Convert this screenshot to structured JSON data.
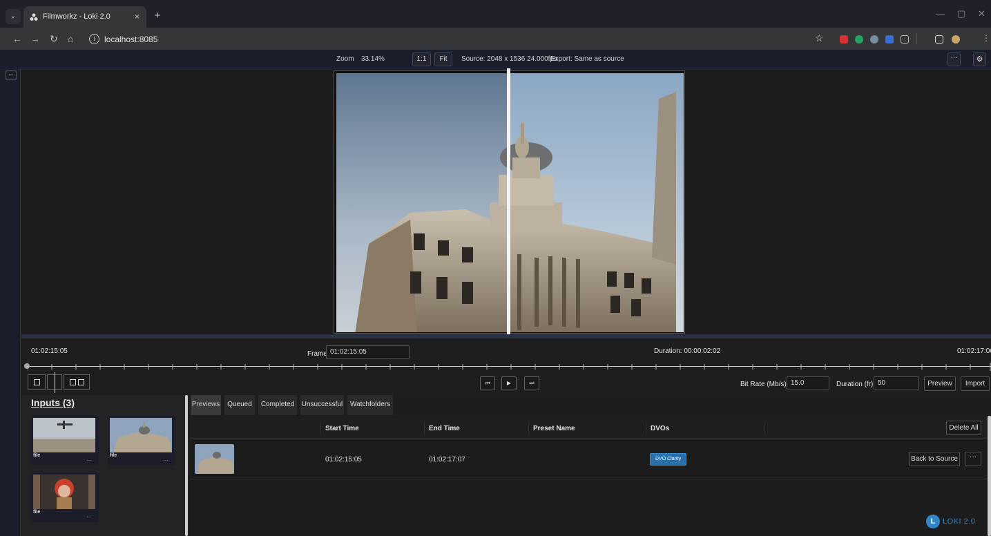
{
  "browser": {
    "tab_title": "Filmworkz - Loki 2.0",
    "tab_close": "×",
    "new_tab": "+",
    "url": "localhost:8085",
    "minimize": "—",
    "restore": "▢",
    "close": "✕"
  },
  "toolbar": {
    "zoom_label": "Zoom",
    "zoom_value": "33.14%",
    "one_to_one": "1:1",
    "fit": "Fit",
    "source_info": "Source: 2048 x 1536 24.000fps",
    "export_info": "Export: Same as source",
    "more": "···",
    "settings_icon": "gear-icon"
  },
  "gutter": {
    "more": "···"
  },
  "timeline": {
    "start_tc": "01:02:15:05",
    "frame_label": "Frame",
    "frame_value": "01:02:15:05",
    "duration": "Duration: 00:00:02:02",
    "end_tc": "01:02:17:06",
    "bitrate_label": "Bit Rate (Mb/s):",
    "bitrate_value": "15.0",
    "duration_fr_label": "Duration (fr):",
    "duration_fr_value": "50",
    "preview": "Preview",
    "import": "Import",
    "prev": "⏮",
    "play": "▶",
    "next": "⏭"
  },
  "inputs": {
    "title": "Inputs (3)",
    "items": [
      {
        "label": "file",
        "menu": "···",
        "thumb": "plane"
      },
      {
        "label": "file",
        "menu": "···",
        "thumb": "building"
      },
      {
        "label": "file",
        "menu": "···",
        "thumb": "child"
      }
    ]
  },
  "queue": {
    "tabs": [
      "Previews",
      "Queued",
      "Completed",
      "Unsuccessful",
      "Watchfolders"
    ],
    "active_tab": "Previews",
    "headers": {
      "start": "Start Time",
      "end": "End Time",
      "preset": "Preset Name",
      "dvos": "DVOs"
    },
    "delete_all": "Delete All",
    "rows": [
      {
        "start": "01:02:15:05",
        "end": "01:02:17:07",
        "preset": "",
        "dvo": "DVO Clarity",
        "action": "Back to Source",
        "menu": "···"
      }
    ]
  },
  "logo": {
    "mark": "L",
    "text": "LOKI 2.0"
  },
  "colors": {
    "accent": "#2f86c9",
    "badge": "#2a6fa8",
    "panel": "#1a1d2a"
  }
}
